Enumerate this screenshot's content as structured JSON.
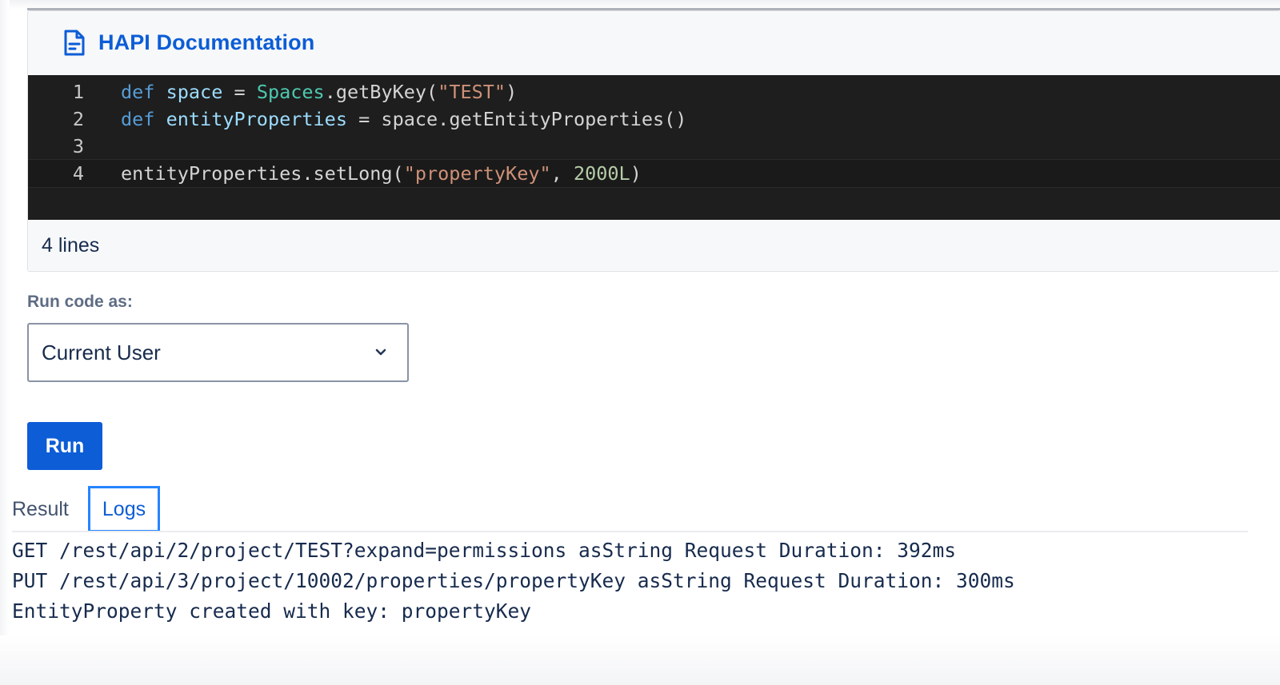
{
  "header": {
    "doc_link_label": "HAPI Documentation",
    "doc_icon": "document-icon"
  },
  "editor": {
    "line_numbers": [
      "1",
      "2",
      "3",
      "4"
    ],
    "lines": [
      {
        "tokens": [
          [
            "kw",
            "def"
          ],
          [
            "plain",
            " "
          ],
          [
            "var",
            "space"
          ],
          [
            "plain",
            " = "
          ],
          [
            "cls",
            "Spaces"
          ],
          [
            "plain",
            ".getByKey("
          ],
          [
            "str",
            "\"TEST\""
          ],
          [
            "plain",
            ")"
          ]
        ]
      },
      {
        "tokens": [
          [
            "kw",
            "def"
          ],
          [
            "plain",
            " "
          ],
          [
            "var",
            "entityProperties"
          ],
          [
            "plain",
            " = space.getEntityProperties()"
          ]
        ]
      },
      {
        "tokens": []
      },
      {
        "tokens": [
          [
            "plain",
            "entityProperties.setLong("
          ],
          [
            "str",
            "\"propertyKey\""
          ],
          [
            "plain",
            ", "
          ],
          [
            "num",
            "2000L"
          ],
          [
            "plain",
            ")"
          ]
        ]
      }
    ],
    "footer": "4 lines"
  },
  "run_as": {
    "label": "Run code as:",
    "selected": "Current User",
    "chevron_icon": "chevron-down-icon"
  },
  "run_button": {
    "label": "Run"
  },
  "tabs": [
    {
      "label": "Result",
      "active": false
    },
    {
      "label": "Logs",
      "active": true
    }
  ],
  "logs": [
    "GET /rest/api/2/project/TEST?expand=permissions asString Request Duration: 392ms",
    "PUT /rest/api/3/project/10002/properties/propertyKey asString Request Duration: 300ms",
    "EntityProperty created with key: propertyKey"
  ],
  "colors": {
    "brand_blue": "#0c5dd6",
    "editor_bg": "#1e1e1e",
    "focus_ring": "#2684ff"
  }
}
